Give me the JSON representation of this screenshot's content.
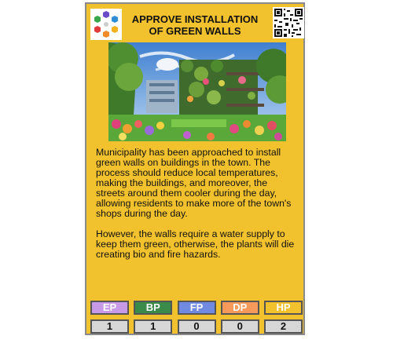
{
  "card": {
    "title_line1": "APPROVE INSTALLATION",
    "title_line2": "OF GREEN WALLS",
    "paragraphs": [
      "Municipality has been approached to install green walls on buildings in the town. The process should reduce local temperatures, making the buildings, and moreover, the streets around them cooler during the day, allowing residents to make more of the town's shops during the day.",
      "However, the walls require a water supply to keep them green, otherwise, the plants will die creating bio and fire hazards."
    ],
    "stats": [
      {
        "label": "EP",
        "value": "1",
        "color": "#c69ae6"
      },
      {
        "label": "BP",
        "value": "1",
        "color": "#3a8a4a"
      },
      {
        "label": "FP",
        "value": "0",
        "color": "#6f8ae0"
      },
      {
        "label": "DP",
        "value": "0",
        "color": "#f59a5a"
      },
      {
        "label": "HP",
        "value": "2",
        "color": "#f2c12e"
      }
    ]
  },
  "colors": {
    "card_background": "#f2c12e",
    "card_border": "#8a8a8a",
    "value_box": "#d7d7d7"
  },
  "icons": {
    "logo": "hexagon-ring-logo",
    "qr": "qr-code"
  }
}
